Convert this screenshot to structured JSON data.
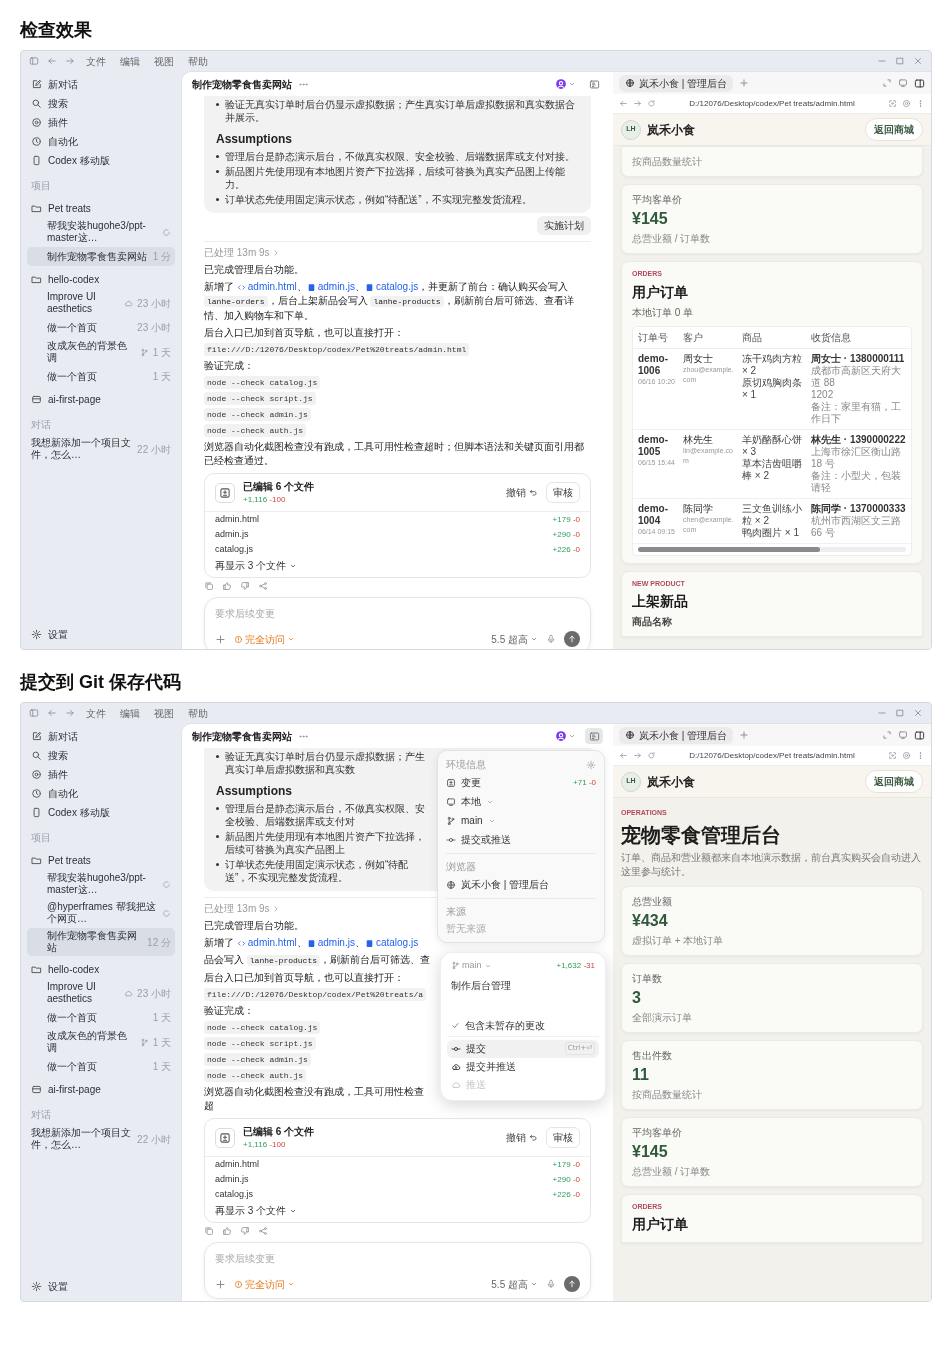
{
  "sections": [
    {
      "heading": "检查效果",
      "screen": {
        "menu": [
          "文件",
          "编辑",
          "视图",
          "帮助"
        ],
        "sidebar": {
          "nav": [
            {
              "kind": "compose",
              "label": "新对话"
            },
            {
              "kind": "search",
              "label": "搜索"
            },
            {
              "kind": "plugin",
              "label": "插件"
            },
            {
              "kind": "clock",
              "label": "自动化"
            },
            {
              "kind": "phone",
              "label": "Codex 移动版"
            }
          ],
          "projects_label": "项目",
          "projects": [
            {
              "name": "Pet treats",
              "kind": "folder",
              "children": [
                {
                  "title": "帮我安装hugohe3/ppt-master这…",
                  "kind": "running",
                  "selected": false
                },
                {
                  "title": "制作宠物零食售卖网站",
                  "kind": "plain",
                  "meta": "1 分",
                  "selected": true
                }
              ]
            },
            {
              "name": "hello-codex",
              "kind": "folder",
              "children": [
                {
                  "title": "Improve UI aesthetics",
                  "kind": "cloud",
                  "meta": "23 小时",
                  "selected": false
                },
                {
                  "title": "做一个首页",
                  "kind": "plain",
                  "meta": "23 小时",
                  "selected": false
                },
                {
                  "title": "改成灰色的背景色调",
                  "kind": "branch",
                  "meta": "1 天",
                  "selected": false
                },
                {
                  "title": "做一个首页",
                  "kind": "plain",
                  "meta": "1 天",
                  "selected": false
                }
              ]
            },
            {
              "name": "ai-first-page",
              "kind": "box"
            }
          ],
          "chats_label": "对话",
          "chats": [
            {
              "title": "我想新添加一个项目文件，怎么…",
              "meta": "22 小时",
              "selected": false
            }
          ],
          "settings": "设置"
        },
        "chat": {
          "title": "制作宠物零食售卖网站",
          "panel_open": false,
          "plan": {
            "top_bullets": [
              "验证无真实订单时后台仍显示虚拟数据；产生真实订单后虚拟数据和真实数据合并展示。"
            ],
            "heading": "Assumptions",
            "bullets": [
              "管理后台是静态演示后台，不做真实权限、安全校验、后端数据库或支付对接。",
              "新品图片先使用现有本地图片资产下拉选择，后续可替换为真实产品图上传能力。",
              "订单状态先使用固定演示状态，例如“待配送”，不实现完整发货流程。"
            ]
          },
          "plan_button": "实施计划",
          "processed": "已处理 13m 9s",
          "blocks": [
            {
              "kind": "text",
              "segments": [
                {
                  "kind": "plain",
                  "text": "已完成管理后台功能。"
                }
              ]
            },
            {
              "kind": "text",
              "segments": [
                {
                  "kind": "plain",
                  "text": "新增了 "
                },
                {
                  "kind": "html_link",
                  "text": "admin.html"
                },
                {
                  "kind": "plain",
                  "text": "、"
                },
                {
                  "kind": "js_link",
                  "text": "admin.js"
                },
                {
                  "kind": "plain",
                  "text": "、"
                },
                {
                  "kind": "js_link",
                  "text": "catalog.js"
                },
                {
                  "kind": "plain",
                  "text": "，并更新了前台：确认购买会写入 "
                },
                {
                  "kind": "code",
                  "text": "lanhe-orders"
                },
                {
                  "kind": "plain",
                  "text": "，后台上架新品会写入 "
                },
                {
                  "kind": "code",
                  "text": "lanhe-products"
                },
                {
                  "kind": "plain",
                  "text": "，刷新前台后可筛选、查看详情、加入购物车和下单。"
                }
              ]
            },
            {
              "kind": "text",
              "segments": [
                {
                  "kind": "plain",
                  "text": "后台入口已加到首页导航，也可以直接打开："
                }
              ]
            },
            {
              "kind": "code",
              "text": "file:///D:/12076/Desktop/codex/Pet%20treats/admin.html"
            },
            {
              "kind": "text",
              "segments": [
                {
                  "kind": "plain",
                  "text": "验证完成："
                }
              ]
            },
            {
              "kind": "code",
              "text": "node --check catalog.js"
            },
            {
              "kind": "code",
              "text": "node --check script.js"
            },
            {
              "kind": "code",
              "text": "node --check admin.js"
            },
            {
              "kind": "code",
              "text": "node --check auth.js"
            },
            {
              "kind": "text",
              "segments": [
                {
                  "kind": "plain",
                  "text": "浏览器自动化截图检查没有跑成，工具可用性检查超时；但脚本语法和关键页面引用都已经检查通过。"
                }
              ]
            }
          ],
          "files": {
            "title": "已编辑 6 个文件",
            "added": "+1,116",
            "removed": "-100",
            "undo": "撤销",
            "review": "审核",
            "items": [
              {
                "name": "admin.html",
                "added": "+179",
                "removed": "-0"
              },
              {
                "name": "admin.js",
                "added": "+290",
                "removed": "-0"
              },
              {
                "name": "catalog.js",
                "added": "+226",
                "removed": "-0"
              }
            ],
            "more": "再显示 3 个文件"
          },
          "composer": {
            "placeholder": "要求后续变更",
            "access": "完全访问",
            "model": "5.5 超高"
          }
        },
        "browser": {
          "tab": "岚禾小食 | 管理后台",
          "url": "D:/12076/Desktop/codex/Pet treats/admin.html",
          "brand_initials": "LH",
          "brand": "岚禾小食",
          "back_button": "返回商城",
          "blocks": [
            {
              "kind": "stat_tail",
              "caption": "按商品数量统计"
            },
            {
              "kind": "stat",
              "label": "平均客单价",
              "value": "¥145",
              "caption": "总营业额 / 订单数"
            },
            {
              "kind": "orders",
              "eyebrow": "ORDERS",
              "title": "用户订单",
              "subtitle": "本地订单 0 单",
              "columns": [
                "订单号",
                "客户",
                "商品",
                "收货信息"
              ],
              "rows": [
                {
                  "order_id": "demo-1006",
                  "time": "06/16 10:20",
                  "customer": "周女士",
                  "email": "zhou@example.com",
                  "items": [
                    "冻干鸡肉方粒 × 2",
                    "原切鸡胸肉条 × 1"
                  ],
                  "shipping": [
                    "周女士 · 1380000111",
                    "成都市高新区天府大道 88",
                    "1202",
                    "备注：家里有猫，工作日下"
                  ]
                },
                {
                  "order_id": "demo-1005",
                  "time": "06/15 15:44",
                  "customer": "林先生",
                  "email": "lin@example.com",
                  "items": [
                    "羊奶酪酥心饼 × 3",
                    "草本洁齿咀嚼棒 × 2"
                  ],
                  "shipping": [
                    "林先生 · 1390000222",
                    "上海市徐汇区衡山路 18 号",
                    "备注：小型犬，包装请轻"
                  ]
                },
                {
                  "order_id": "demo-1004",
                  "time": "06/14 09:15",
                  "customer": "陈同学",
                  "email": "chen@example.com",
                  "items": [
                    "三文鱼训练小粒 × 2",
                    "鸭肉圈片 × 1"
                  ],
                  "shipping": [
                    "陈同学 · 1370000333",
                    "杭州市西湖区文三路 66 号"
                  ]
                }
              ]
            },
            {
              "kind": "section",
              "eyebrow": "NEW PRODUCT",
              "title": "上架新品",
              "field_label": "商品名称"
            }
          ]
        }
      }
    },
    {
      "heading": "提交到 Git 保存代码",
      "screen": {
        "menu": [
          "文件",
          "编辑",
          "视图",
          "帮助"
        ],
        "sidebar": {
          "nav": [
            {
              "kind": "compose",
              "label": "新对话"
            },
            {
              "kind": "search",
              "label": "搜索"
            },
            {
              "kind": "plugin",
              "label": "插件"
            },
            {
              "kind": "clock",
              "label": "自动化"
            },
            {
              "kind": "phone",
              "label": "Codex 移动版"
            }
          ],
          "projects_label": "项目",
          "projects": [
            {
              "name": "Pet treats",
              "kind": "folder",
              "children": [
                {
                  "title": "帮我安装hugohe3/ppt-master这…",
                  "kind": "running",
                  "selected": false
                },
                {
                  "title": "@hyperframes 帮我把这个网页…",
                  "kind": "running",
                  "selected": false
                },
                {
                  "title": "制作宠物零食售卖网站",
                  "kind": "plain",
                  "meta": "12 分",
                  "selected": true
                }
              ]
            },
            {
              "name": "hello-codex",
              "kind": "folder",
              "children": [
                {
                  "title": "Improve UI aesthetics",
                  "kind": "cloud",
                  "meta": "23 小时",
                  "selected": false
                },
                {
                  "title": "做一个首页",
                  "kind": "plain",
                  "meta": "1 天",
                  "selected": false
                },
                {
                  "title": "改成灰色的背景色调",
                  "kind": "branch",
                  "meta": "1 天",
                  "selected": false
                },
                {
                  "title": "做一个首页",
                  "kind": "plain",
                  "meta": "1 天",
                  "selected": false
                }
              ]
            },
            {
              "name": "ai-first-page",
              "kind": "box"
            }
          ],
          "chats_label": "对话",
          "chats": [
            {
              "title": "我想新添加一个项目文件，怎么…",
              "meta": "22 小时",
              "selected": false
            }
          ],
          "settings": "设置"
        },
        "chat": {
          "title": "制作宠物零食售卖网站",
          "panel_open": true,
          "plan": {
            "top_bullets": [
              "验证无真实订单时后台仍显示虚拟数据；产生真实订单后虚拟数据和真实数"
            ],
            "heading": "Assumptions",
            "bullets": [
              "管理后台是静态演示后台，不做真实权限、安全校验、后端数据库或支付对",
              "新品图片先使用现有本地图片资产下拉选择，后续可替换为真实产品图上",
              "订单状态先使用固定演示状态，例如“待配送”，不实现完整发货流程。"
            ]
          },
          "processed": "已处理 13m 9s",
          "blocks": [
            {
              "kind": "text",
              "segments": [
                {
                  "kind": "plain",
                  "text": "已完成管理后台功能。"
                }
              ]
            },
            {
              "kind": "text",
              "segments": [
                {
                  "kind": "plain",
                  "text": "新增了 "
                },
                {
                  "kind": "html_link",
                  "text": "admin.html"
                },
                {
                  "kind": "plain",
                  "text": "、"
                },
                {
                  "kind": "js_link",
                  "text": "admin.js"
                },
                {
                  "kind": "plain",
                  "text": "、"
                },
                {
                  "kind": "js_link",
                  "text": "catalog.js"
                }
              ]
            },
            {
              "kind": "text",
              "segments": [
                {
                  "kind": "plain",
                  "text": "品会写入 "
                },
                {
                  "kind": "code",
                  "text": "lanhe-products"
                },
                {
                  "kind": "plain",
                  "text": "，刷新前台后可筛选、查"
                }
              ]
            },
            {
              "kind": "text",
              "segments": [
                {
                  "kind": "plain",
                  "text": "后台入口已加到首页导航，也可以直接打开："
                }
              ]
            },
            {
              "kind": "code",
              "text": "file:///D:/12076/Desktop/codex/Pet%20treats/a"
            },
            {
              "kind": "text",
              "segments": [
                {
                  "kind": "plain",
                  "text": "验证完成："
                }
              ]
            },
            {
              "kind": "code",
              "text": "node --check catalog.js"
            },
            {
              "kind": "code",
              "text": "node --check script.js"
            },
            {
              "kind": "code",
              "text": "node --check admin.js"
            },
            {
              "kind": "code",
              "text": "node --check auth.js"
            },
            {
              "kind": "text",
              "segments": [
                {
                  "kind": "plain",
                  "text": "浏览器自动化截图检查没有跑成，工具可用性检查超"
                }
              ]
            }
          ],
          "files": {
            "title": "已编辑 6 个文件",
            "added": "+1,116",
            "removed": "-100",
            "undo": "撤销",
            "review": "审核",
            "items": [
              {
                "name": "admin.html",
                "added": "+179",
                "removed": "-0"
              },
              {
                "name": "admin.js",
                "added": "+290",
                "removed": "-0"
              },
              {
                "name": "catalog.js",
                "added": "+226",
                "removed": "-0"
              }
            ],
            "more": "再显示 3 个文件"
          },
          "composer": {
            "placeholder": "要求后续变更",
            "access": "完全访问",
            "model": "5.5 超高"
          },
          "env_panel": {
            "title": "环境信息",
            "items": [
              {
                "kind": "diff",
                "label": "变更",
                "dropdown": false,
                "added": "+71",
                "removed": "-0"
              },
              {
                "kind": "screen",
                "label": "本地",
                "dropdown": true
              },
              {
                "kind": "branch",
                "label": "main",
                "dropdown": true
              },
              {
                "kind": "commit",
                "label": "提交或推送",
                "dropdown": false
              }
            ],
            "browser_label": "浏览器",
            "browser_item": "岚禾小食 | 管理后台",
            "source_label": "来源",
            "source_empty": "暂无来源"
          },
          "commit_popover": {
            "branch": "main",
            "added": "+1,632",
            "removed": "-31",
            "message": "制作后台管理",
            "include_unstaged": {
              "label": "包含未暂存的更改",
              "checked": true
            },
            "actions": [
              {
                "kind": "commit",
                "label": "提交",
                "shortcut": "Ctrl+⏎",
                "selected": true,
                "disabled": false
              },
              {
                "kind": "cloud_up",
                "label": "提交并推送",
                "selected": false,
                "disabled": false
              },
              {
                "kind": "cloud",
                "label": "推送",
                "selected": false,
                "disabled": true
              }
            ]
          }
        },
        "browser": {
          "tab": "岚禾小食 | 管理后台",
          "url": "D:/12076/Desktop/codex/Pet treats/admin.html",
          "brand_initials": "LH",
          "brand": "岚禾小食",
          "back_button": "返回商城",
          "blocks": [
            {
              "kind": "intro",
              "eyebrow": "OPERATIONS",
              "title": "宠物零食管理后台",
              "description": "订单、商品和营业额都来自本地演示数据，前台真实购买会自动进入这里参与统计。"
            },
            {
              "kind": "stat",
              "label": "总营业额",
              "value": "¥434",
              "caption": "虚拟订单 + 本地订单"
            },
            {
              "kind": "stat",
              "label": "订单数",
              "value": "3",
              "caption": "全部演示订单"
            },
            {
              "kind": "stat",
              "label": "售出件数",
              "value": "11",
              "caption": "按商品数量统计"
            },
            {
              "kind": "stat",
              "label": "平均客单价",
              "value": "¥145",
              "caption": "总营业额 / 订单数"
            },
            {
              "kind": "section",
              "eyebrow": "ORDERS",
              "title": "用户订单"
            }
          ]
        }
      }
    }
  ]
}
